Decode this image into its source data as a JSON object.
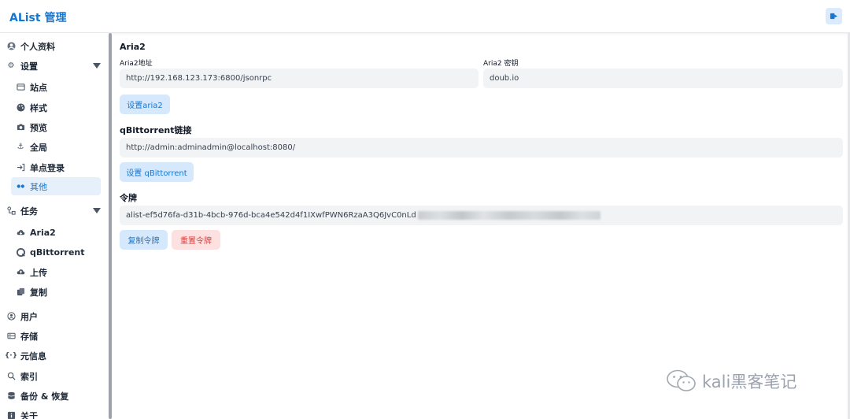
{
  "header": {
    "title": "AList 管理"
  },
  "sidebar": {
    "items": [
      {
        "label": "个人资料",
        "icon": "user-circle-icon"
      },
      {
        "label": "设置",
        "icon": "gear-icon"
      },
      {
        "label": "站点",
        "icon": "window-icon"
      },
      {
        "label": "样式",
        "icon": "palette-icon"
      },
      {
        "label": "预览",
        "icon": "camera-icon"
      },
      {
        "label": "全局",
        "icon": "anchor-icon"
      },
      {
        "label": "单点登录",
        "icon": "login-icon"
      },
      {
        "label": "其他",
        "icon": "dots-icon"
      },
      {
        "label": "任务",
        "icon": "workflow-icon"
      },
      {
        "label": "Aria2",
        "icon": "cloud-download-icon"
      },
      {
        "label": "qBittorrent",
        "icon": "qbittorrent-icon"
      },
      {
        "label": "上传",
        "icon": "cloud-upload-icon"
      },
      {
        "label": "复制",
        "icon": "copy-icon"
      },
      {
        "label": "用户",
        "icon": "user-icon"
      },
      {
        "label": "存储",
        "icon": "database-icon"
      },
      {
        "label": "元信息",
        "icon": "braces-icon"
      },
      {
        "label": "索引",
        "icon": "search-icon"
      },
      {
        "label": "备份 & 恢复",
        "icon": "database-stack-icon"
      },
      {
        "label": "关于",
        "icon": "info-icon"
      }
    ]
  },
  "main": {
    "aria2": {
      "title": "Aria2",
      "address_label": "Aria2地址",
      "address_value": "http://192.168.123.173:6800/jsonrpc",
      "secret_label": "Aria2 密钥",
      "secret_value": "doub.io",
      "button": "设置aria2"
    },
    "qbittorrent": {
      "title": "qBittorrent链接",
      "url_value": "http://admin:adminadmin@localhost:8080/",
      "button": "设置 qBittorrent"
    },
    "token": {
      "title": "令牌",
      "value": "alist-ef5d76fa-d31b-4bcb-976d-bca4e542d4f1IXwfPWN6RzaA3Q6JvC0nLd",
      "copy_button": "复制令牌",
      "reset_button": "重置令牌"
    }
  },
  "watermark": {
    "text": "kali黑客笔记"
  },
  "colors": {
    "accent": "#1677d2",
    "danger": "#e23b3b",
    "active_bg": "#e6f0fb"
  }
}
